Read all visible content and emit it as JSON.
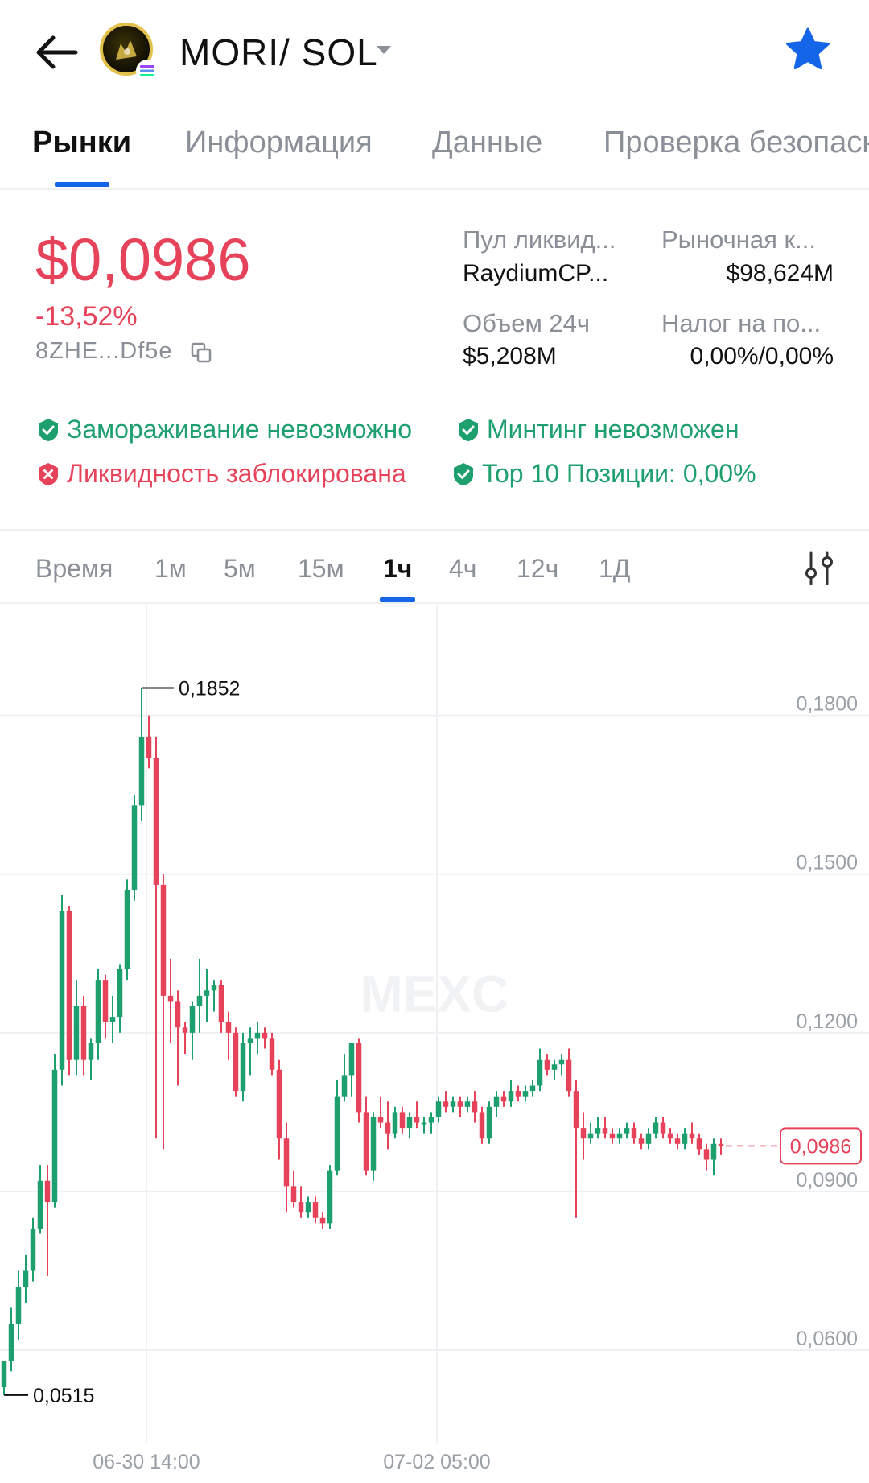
{
  "header": {
    "pair": "MORI/ SOL",
    "back_icon": "arrow-left-icon",
    "favorite_icon": "star-icon",
    "favorite_color": "#1565e8"
  },
  "tabs": [
    {
      "label": "Рынки",
      "active": true
    },
    {
      "label": "Информация",
      "active": false
    },
    {
      "label": "Данные",
      "active": false
    },
    {
      "label": "Проверка безопасности",
      "active": false
    }
  ],
  "price": {
    "value": "$0,0986",
    "change": "-13,52%",
    "address": "8ZHE...Df5e",
    "color": "#e6435a"
  },
  "stats": {
    "pool_label": "Пул ликвид...",
    "pool_value": "RaydiumCP...",
    "mcap_label": "Рыночная к...",
    "mcap_value": "$98,624M",
    "volume_label": "Объем 24ч",
    "volume_value": "$5,208M",
    "tax_label": "Налог на по...",
    "tax_value": "0,00%/0,00%"
  },
  "checks": [
    {
      "label": "Замораживание невозможно",
      "status": "ok"
    },
    {
      "label": "Минтинг невозможен",
      "status": "ok"
    },
    {
      "label": "Ликвидность заблокирована",
      "status": "bad"
    },
    {
      "label": "Top 10 Позиции: 0,00%",
      "status": "ok"
    }
  ],
  "intervals": [
    {
      "label": "Время",
      "active": false
    },
    {
      "label": "1м",
      "active": false
    },
    {
      "label": "5м",
      "active": false
    },
    {
      "label": "15м",
      "active": false
    },
    {
      "label": "1ч",
      "active": true
    },
    {
      "label": "4ч",
      "active": false
    },
    {
      "label": "12ч",
      "active": false
    },
    {
      "label": "1Д",
      "active": false
    }
  ],
  "chart_data": {
    "type": "candlestick",
    "watermark": "MEXC",
    "y_ticks": [
      "0,1800",
      "0,1500",
      "0,1200",
      "0,0900",
      "0,0600"
    ],
    "y_tick_values": [
      0.18,
      0.15,
      0.12,
      0.09,
      0.06
    ],
    "ylim": [
      0.0425,
      0.2008
    ],
    "x_ticks": [
      "06-30 14:00",
      "07-02 05:00"
    ],
    "high_label": "0,1852",
    "low_label": "0,0515",
    "last_price_label": "0,0986",
    "last_price": 0.0986,
    "up_color": "#1d9f6e",
    "down_color": "#e6435a",
    "candles": [
      [
        0.053,
        0.058,
        0.0515,
        0.058
      ],
      [
        0.058,
        0.068,
        0.056,
        0.065
      ],
      [
        0.065,
        0.075,
        0.062,
        0.072
      ],
      [
        0.072,
        0.078,
        0.069,
        0.075
      ],
      [
        0.075,
        0.085,
        0.073,
        0.083
      ],
      [
        0.083,
        0.095,
        0.082,
        0.092
      ],
      [
        0.092,
        0.095,
        0.074,
        0.088
      ],
      [
        0.088,
        0.116,
        0.087,
        0.113
      ],
      [
        0.113,
        0.146,
        0.11,
        0.143
      ],
      [
        0.143,
        0.144,
        0.112,
        0.115
      ],
      [
        0.115,
        0.13,
        0.112,
        0.125
      ],
      [
        0.125,
        0.127,
        0.112,
        0.115
      ],
      [
        0.115,
        0.119,
        0.111,
        0.118
      ],
      [
        0.118,
        0.132,
        0.115,
        0.13
      ],
      [
        0.13,
        0.131,
        0.119,
        0.122
      ],
      [
        0.122,
        0.127,
        0.118,
        0.123
      ],
      [
        0.123,
        0.133,
        0.12,
        0.132
      ],
      [
        0.132,
        0.149,
        0.13,
        0.147
      ],
      [
        0.147,
        0.165,
        0.145,
        0.163
      ],
      [
        0.163,
        0.1852,
        0.16,
        0.176
      ],
      [
        0.176,
        0.18,
        0.17,
        0.172
      ],
      [
        0.172,
        0.176,
        0.1,
        0.148
      ],
      [
        0.148,
        0.15,
        0.098,
        0.127
      ],
      [
        0.127,
        0.134,
        0.118,
        0.126
      ],
      [
        0.126,
        0.128,
        0.11,
        0.121
      ],
      [
        0.121,
        0.122,
        0.116,
        0.12
      ],
      [
        0.12,
        0.126,
        0.115,
        0.125
      ],
      [
        0.125,
        0.134,
        0.12,
        0.127
      ],
      [
        0.127,
        0.132,
        0.122,
        0.128
      ],
      [
        0.128,
        0.13,
        0.124,
        0.129
      ],
      [
        0.129,
        0.13,
        0.12,
        0.122
      ],
      [
        0.122,
        0.124,
        0.115,
        0.12
      ],
      [
        0.12,
        0.121,
        0.108,
        0.109
      ],
      [
        0.109,
        0.12,
        0.107,
        0.118
      ],
      [
        0.118,
        0.121,
        0.112,
        0.119
      ],
      [
        0.119,
        0.122,
        0.116,
        0.12
      ],
      [
        0.12,
        0.121,
        0.117,
        0.119
      ],
      [
        0.119,
        0.12,
        0.112,
        0.113
      ],
      [
        0.113,
        0.115,
        0.096,
        0.1
      ],
      [
        0.1,
        0.103,
        0.086,
        0.091
      ],
      [
        0.091,
        0.094,
        0.087,
        0.088
      ],
      [
        0.088,
        0.091,
        0.085,
        0.086
      ],
      [
        0.086,
        0.089,
        0.085,
        0.088
      ],
      [
        0.088,
        0.089,
        0.084,
        0.085
      ],
      [
        0.085,
        0.086,
        0.083,
        0.084
      ],
      [
        0.084,
        0.095,
        0.083,
        0.094
      ],
      [
        0.094,
        0.111,
        0.093,
        0.108
      ],
      [
        0.108,
        0.116,
        0.107,
        0.112
      ],
      [
        0.112,
        0.118,
        0.108,
        0.118
      ],
      [
        0.118,
        0.119,
        0.103,
        0.105
      ],
      [
        0.105,
        0.108,
        0.093,
        0.094
      ],
      [
        0.094,
        0.105,
        0.092,
        0.104
      ],
      [
        0.104,
        0.108,
        0.102,
        0.103
      ],
      [
        0.103,
        0.107,
        0.098,
        0.101
      ],
      [
        0.101,
        0.106,
        0.1,
        0.105
      ],
      [
        0.105,
        0.106,
        0.101,
        0.102
      ],
      [
        0.102,
        0.105,
        0.1,
        0.104
      ],
      [
        0.104,
        0.107,
        0.102,
        0.103
      ],
      [
        0.103,
        0.104,
        0.101,
        0.103
      ],
      [
        0.103,
        0.105,
        0.101,
        0.104
      ],
      [
        0.104,
        0.108,
        0.103,
        0.107
      ],
      [
        0.107,
        0.109,
        0.105,
        0.106
      ],
      [
        0.106,
        0.108,
        0.105,
        0.107
      ],
      [
        0.107,
        0.108,
        0.104,
        0.106
      ],
      [
        0.106,
        0.108,
        0.105,
        0.107
      ],
      [
        0.107,
        0.109,
        0.103,
        0.105
      ],
      [
        0.105,
        0.106,
        0.099,
        0.1
      ],
      [
        0.1,
        0.107,
        0.099,
        0.106
      ],
      [
        0.106,
        0.109,
        0.104,
        0.108
      ],
      [
        0.108,
        0.109,
        0.106,
        0.107
      ],
      [
        0.107,
        0.111,
        0.106,
        0.109
      ],
      [
        0.109,
        0.11,
        0.107,
        0.108
      ],
      [
        0.108,
        0.11,
        0.107,
        0.109
      ],
      [
        0.109,
        0.111,
        0.108,
        0.11
      ],
      [
        0.11,
        0.117,
        0.109,
        0.115
      ],
      [
        0.115,
        0.116,
        0.112,
        0.113
      ],
      [
        0.113,
        0.115,
        0.111,
        0.114
      ],
      [
        0.114,
        0.116,
        0.112,
        0.115
      ],
      [
        0.115,
        0.117,
        0.108,
        0.109
      ],
      [
        0.109,
        0.111,
        0.085,
        0.102
      ],
      [
        0.102,
        0.105,
        0.096,
        0.1
      ],
      [
        0.1,
        0.103,
        0.099,
        0.101
      ],
      [
        0.101,
        0.104,
        0.1,
        0.102
      ],
      [
        0.102,
        0.104,
        0.1,
        0.101
      ],
      [
        0.101,
        0.102,
        0.099,
        0.1
      ],
      [
        0.1,
        0.102,
        0.099,
        0.101
      ],
      [
        0.101,
        0.103,
        0.1,
        0.102
      ],
      [
        0.102,
        0.103,
        0.099,
        0.1
      ],
      [
        0.1,
        0.101,
        0.098,
        0.099
      ],
      [
        0.099,
        0.102,
        0.098,
        0.101
      ],
      [
        0.101,
        0.104,
        0.1,
        0.103
      ],
      [
        0.103,
        0.104,
        0.1,
        0.101
      ],
      [
        0.101,
        0.102,
        0.099,
        0.1
      ],
      [
        0.1,
        0.101,
        0.098,
        0.099
      ],
      [
        0.099,
        0.102,
        0.098,
        0.101
      ],
      [
        0.101,
        0.103,
        0.099,
        0.1
      ],
      [
        0.1,
        0.101,
        0.097,
        0.098
      ],
      [
        0.098,
        0.099,
        0.094,
        0.096
      ],
      [
        0.096,
        0.1,
        0.093,
        0.099
      ],
      [
        0.099,
        0.1,
        0.097,
        0.0986
      ]
    ]
  }
}
